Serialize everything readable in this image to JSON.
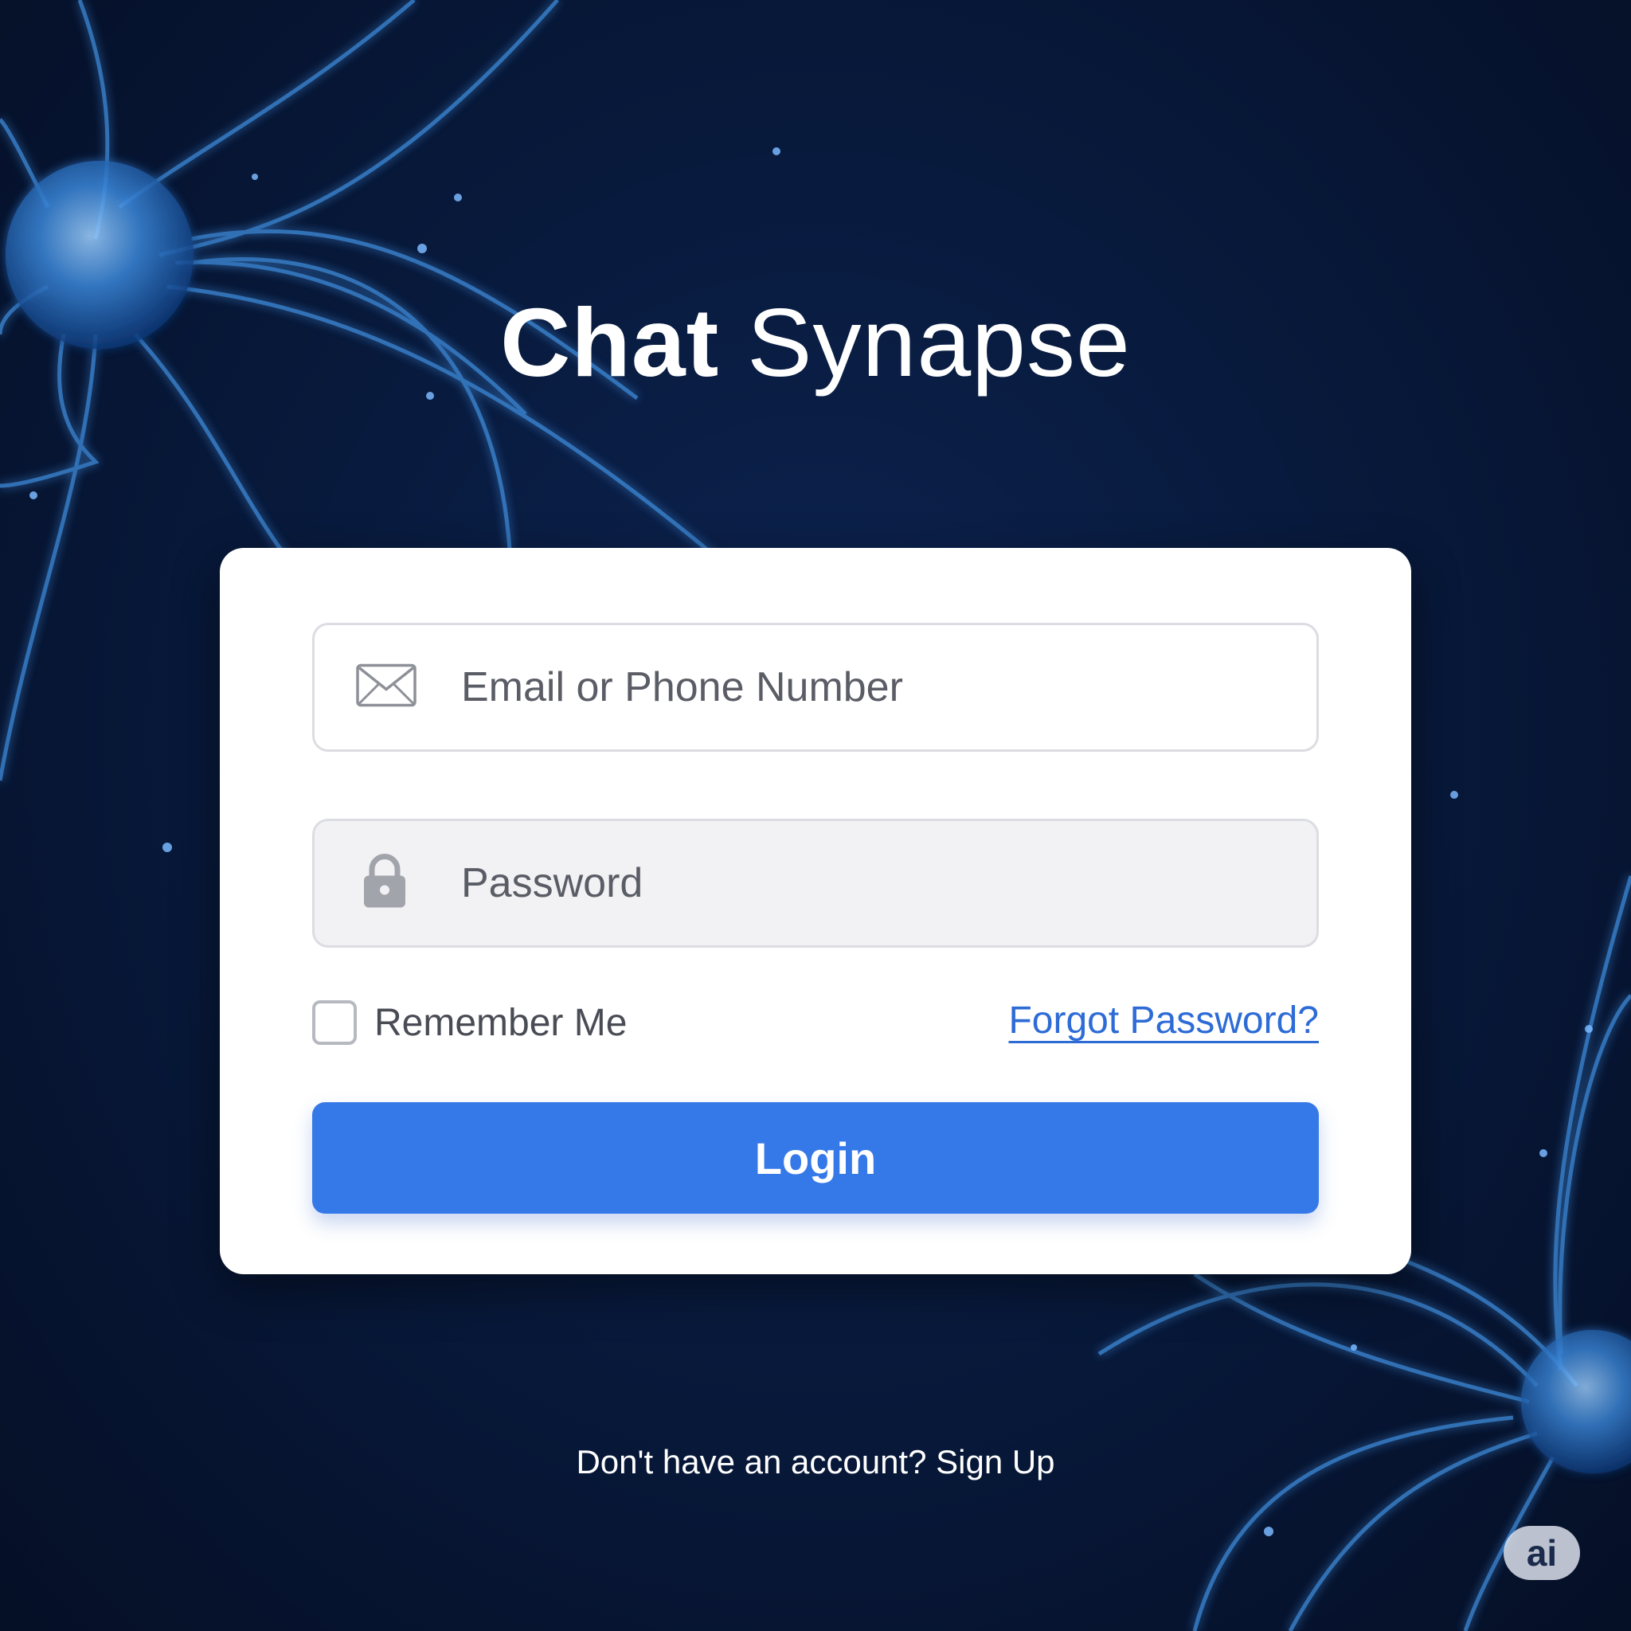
{
  "app": {
    "title_bold": "Chat",
    "title_light": "Synapse"
  },
  "login_form": {
    "email_placeholder": "Email or Phone Number",
    "email_icon": "envelope-icon",
    "password_placeholder": "Password",
    "password_icon": "lock-icon",
    "remember_label": "Remember Me",
    "remember_checked": false,
    "forgot_label": "Forgot Password?",
    "login_label": "Login"
  },
  "footer": {
    "signup_text": "Don't have an account? Sign Up"
  },
  "badge": {
    "label": "ai"
  },
  "colors": {
    "background": "#081a3d",
    "accent": "#3579e8",
    "link": "#2d6bd6",
    "neuron": "#4a9cf0"
  }
}
